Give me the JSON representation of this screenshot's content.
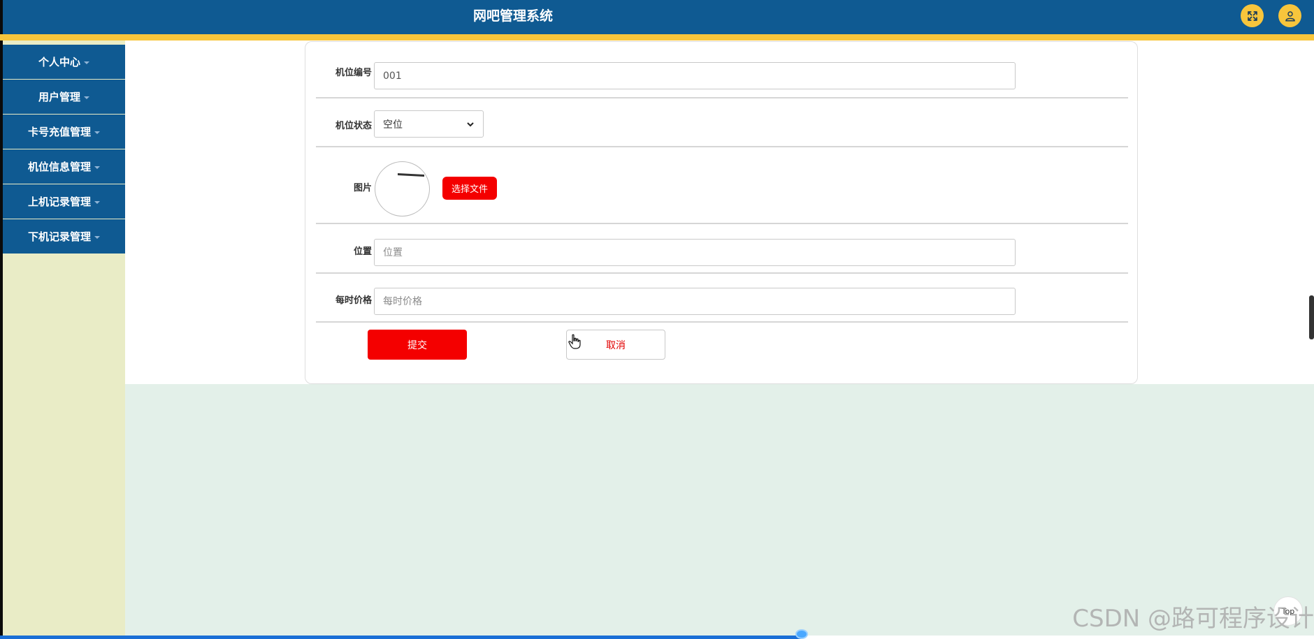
{
  "header": {
    "title": "网吧管理系统",
    "icons": [
      "fullscreen-icon",
      "user-icon"
    ]
  },
  "sidebar": {
    "items": [
      {
        "label": "个人中心"
      },
      {
        "label": "用户管理"
      },
      {
        "label": "卡号充值管理"
      },
      {
        "label": "机位信息管理"
      },
      {
        "label": "上机记录管理"
      },
      {
        "label": "下机记录管理"
      }
    ]
  },
  "form": {
    "seat_number": {
      "label": "机位编号",
      "value": "001"
    },
    "seat_status": {
      "label": "机位状态",
      "selected": "空位"
    },
    "image": {
      "label": "图片",
      "button_label": "选择文件"
    },
    "location": {
      "label": "位置",
      "placeholder": "位置",
      "value": ""
    },
    "hourly_price": {
      "label": "每时价格",
      "placeholder": "每时价格",
      "value": ""
    },
    "submit_label": "提交",
    "cancel_label": "取消"
  },
  "top_button_label": "Top",
  "watermark": "CSDN @路可程序设计",
  "colors": {
    "header_bg": "#0f5a92",
    "header_stripe": "#f7c53c",
    "sidebar_bg": "#e9ecc6",
    "primary_button": "#f40000",
    "content_bg": "#e3f0e9"
  },
  "progress": {
    "fraction": 0.61
  }
}
